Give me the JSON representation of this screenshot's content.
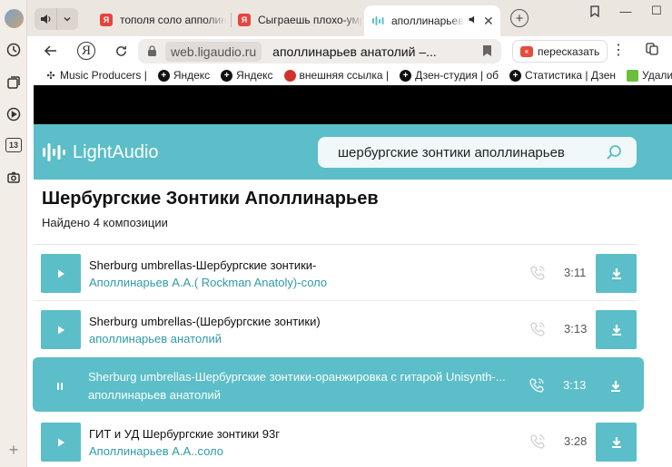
{
  "browser": {
    "audio_tab_control": {
      "speaker_icon": "speaker-icon",
      "dropdown_icon": "chevron-down-icon"
    },
    "tabs": [
      {
        "title": "тополя соло апполин",
        "favicon": "Я",
        "active": false
      },
      {
        "title": "Сыграешь плохо-умр",
        "favicon": "Я",
        "active": false
      },
      {
        "title": "аполлинарьев а",
        "favicon": "lightaudio",
        "active": true,
        "audio": true
      }
    ],
    "toolbar": {
      "domain": "web.ligaudio.ru",
      "page_title": "аполлинарьев анатолий –...",
      "retell_label": "пересказать"
    },
    "bookmarks": [
      {
        "label": "Music Producers |",
        "icon": "grid-icon"
      },
      {
        "label": "Яндекс",
        "icon": "dzen-icon"
      },
      {
        "label": "Яндекс",
        "icon": "dzen-icon"
      },
      {
        "label": "внешняя ссылка |",
        "icon": "red-circle-icon"
      },
      {
        "label": "Дзен-студия | об",
        "icon": "dzen-icon"
      },
      {
        "label": "Статистика | Дзен",
        "icon": "dzen-icon"
      },
      {
        "label": "Удалить п",
        "icon": "green-square-icon"
      }
    ]
  },
  "site": {
    "logo_text": "LightAudio",
    "search_value": "шербургские зонтики аполлинарьев",
    "heading": "Шербургские Зонтики Аполлинарьев",
    "found_text": "Найдено 4 композиции",
    "accent_color": "#5bbec8",
    "tracks": [
      {
        "title": "Sherburg umbrellas-Шербургские зонтики-",
        "artist": "Аполлинарьев А.А.( Rockman Anatoly)-соло",
        "duration": "3:11",
        "state": "idle"
      },
      {
        "title": "Sherburg umbrellas-(Шербургские зонтики)",
        "artist": "аполлинарьев анатолий",
        "duration": "3:13",
        "state": "idle"
      },
      {
        "title": "Sherburg umbrellas-Шербургские зонтики-оранжировка с гитарой Unisynth-...",
        "artist": "аполлинарьев анатолий",
        "duration": "3:13",
        "state": "playing"
      },
      {
        "title": "ГИТ и УД Шербургские зонтики 93г",
        "artist": "Аполлинарьев А.А..соло",
        "duration": "3:28",
        "state": "idle"
      }
    ]
  }
}
